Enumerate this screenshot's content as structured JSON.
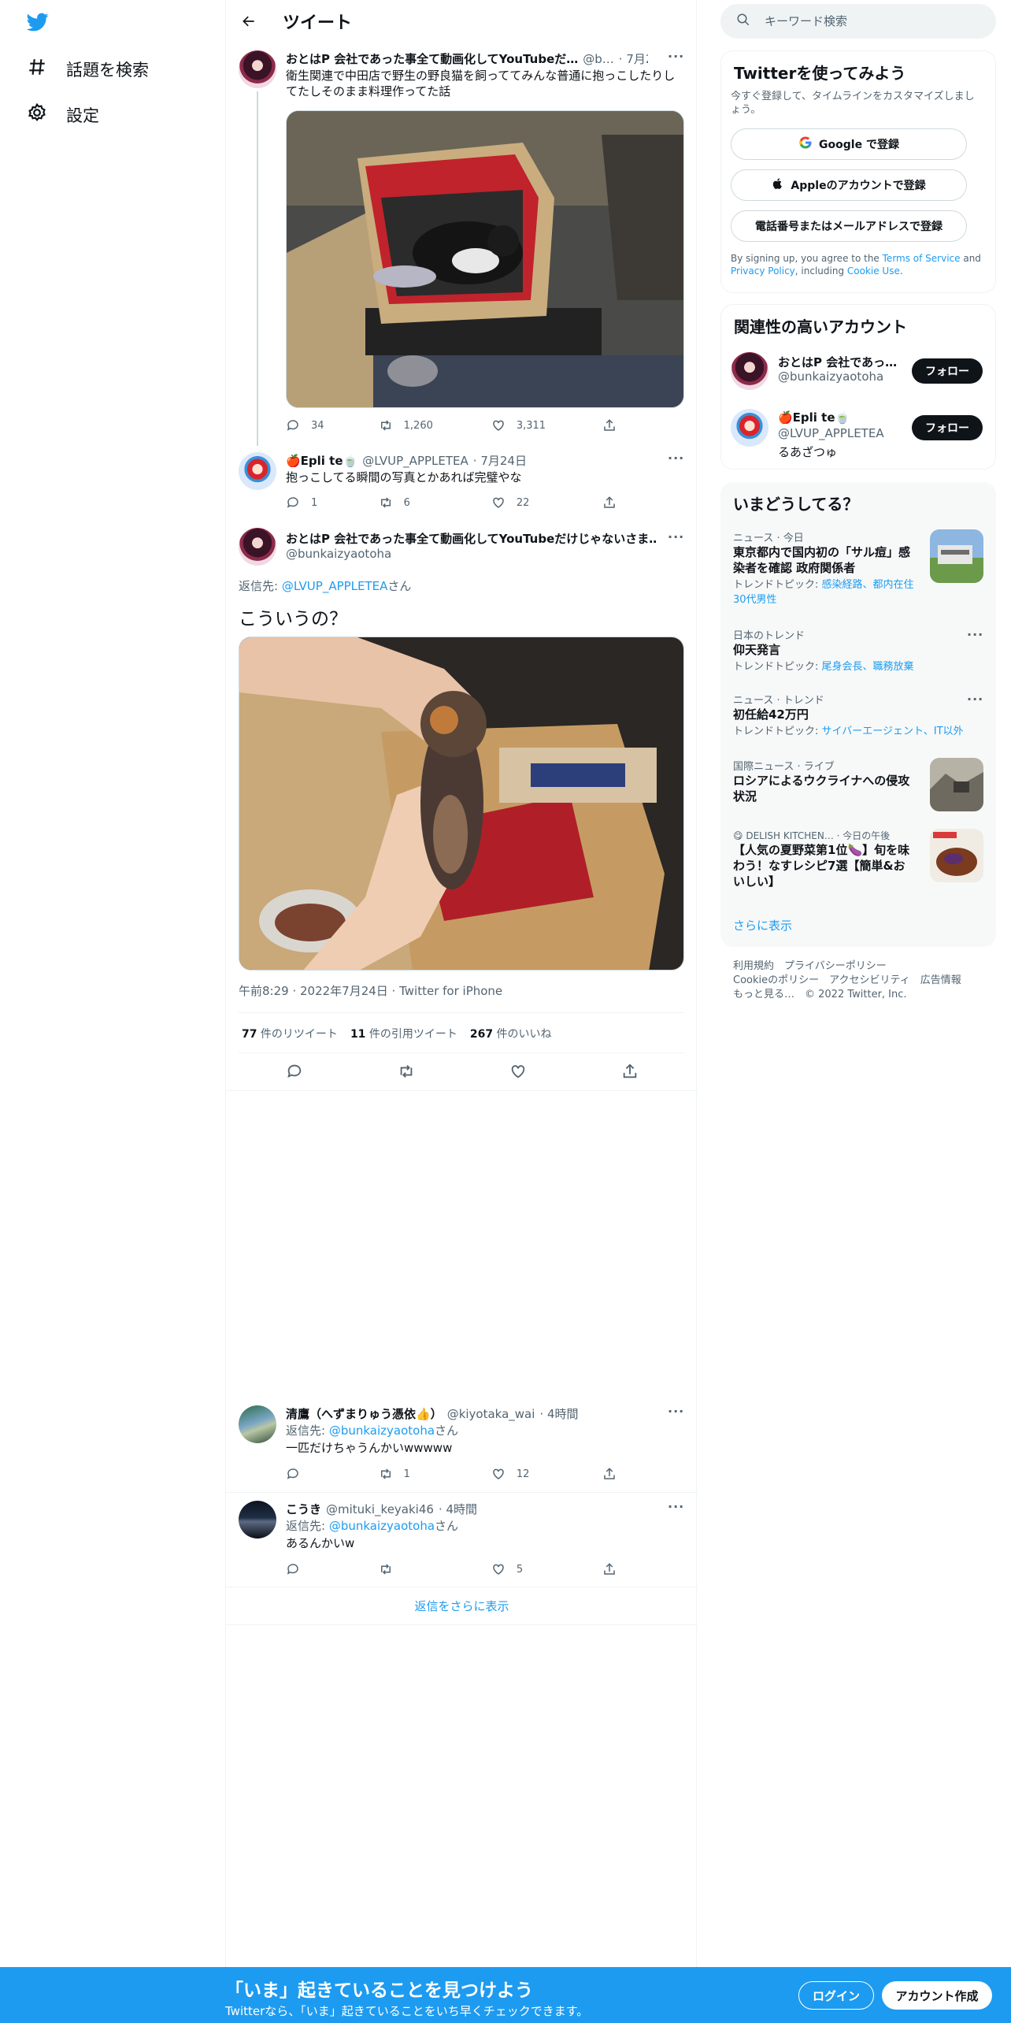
{
  "nav": {
    "explore": "話題を検索",
    "settings": "設定"
  },
  "header": {
    "title": "ツイート"
  },
  "tweets": {
    "parent": {
      "name": "おとはP 会社であった事全て動画化してYouTubeだ…",
      "handle": "@b…",
      "time": "· 7月24日",
      "text": "衛生関連で中田店で野生の野良猫を飼っててみんな普通に抱っこしたりしてたしそのまま料理作ってた話",
      "replies": "34",
      "retweets": "1,260",
      "likes": "3,311"
    },
    "reply1": {
      "name": "🍎Epli te🍵",
      "handle": "@LVUP_APPLETEA",
      "time": "· 7月24日",
      "text": "抱っこしてる瞬間の写真とかあれば完璧やな",
      "replies": "1",
      "retweets": "6",
      "likes": "22"
    },
    "focus": {
      "name": "おとはP 会社であった事全て動画化してYouTubeだけじゃないさま…",
      "handle": "@bunkaizyaotoha",
      "reply_prefix": "返信先: ",
      "reply_to": "@LVUP_APPLETEA",
      "reply_suffix": "さん",
      "text": "こういうの？",
      "meta": "午前8:29 · 2022年7月24日 · Twitter for iPhone",
      "rt_count": "77",
      "rt_label": " 件のリツイート",
      "quote_count": "11",
      "quote_label": " 件の引用ツイート",
      "like_count": "267",
      "like_label": " 件のいいね"
    },
    "reply2": {
      "name": "清鷹（へずまりゅう憑依👍）",
      "handle": "@kiyotaka_wai",
      "time": "· 4時間",
      "reply_prefix": "返信先: ",
      "reply_to": "@bunkaizyaotoha",
      "reply_suffix": "さん",
      "text": "一匹だけちゃうんかいwwwww",
      "replies": "",
      "retweets": "1",
      "likes": "12"
    },
    "reply3": {
      "name": "こうき",
      "handle": "@mituki_keyaki46",
      "time": "· 4時間",
      "reply_prefix": "返信先: ",
      "reply_to": "@bunkaizyaotoha",
      "reply_suffix": "さん",
      "text": "あるんかいw",
      "replies": "",
      "retweets": "",
      "likes": "5"
    },
    "show_more": "返信をさらに表示"
  },
  "sidebar": {
    "search_placeholder": "キーワード検索",
    "signup": {
      "title": "Twitterを使ってみよう",
      "subtitle": "今すぐ登録して、タイムラインをカスタマイズしましょう。",
      "google": "Google で登録",
      "apple": "Appleのアカウントで登録",
      "phone": "電話番号またはメールアドレスで登録",
      "terms_1": "By signing up, you agree to the ",
      "terms_tos": "Terms of Service",
      "terms_2": " and ",
      "terms_pp": "Privacy Policy",
      "terms_3": ", including ",
      "terms_cookie": "Cookie Use",
      "terms_4": "."
    },
    "related": {
      "title": "関連性の高いアカウント",
      "accounts": [
        {
          "name": "おとはP 会社であっ…",
          "handle": "@bunkaizyaotoha",
          "bio": "",
          "button": "フォロー"
        },
        {
          "name": "🍎Epli te🍵",
          "handle": "@LVUP_APPLETEA",
          "bio": "るあざつゅ",
          "button": "フォロー"
        }
      ]
    },
    "trends": {
      "title": "いまどうしてる？",
      "items": [
        {
          "context": "ニュース · 今日",
          "title": "東京都内で国内初の「サル痘」感染者を確認 政府関係者",
          "sub_prefix": "トレンドトピック: ",
          "sub": "感染経路、都内在住30代男性"
        },
        {
          "context": "日本のトレンド",
          "title": "仰天発言",
          "sub_prefix": "トレンドトピック: ",
          "sub": "尾身会長、職務放棄"
        },
        {
          "context": "ニュース · トレンド",
          "title": "初任給42万円",
          "sub_prefix": "トレンドトピック: ",
          "sub": "サイバーエージェント、IT以外"
        },
        {
          "context": "国際ニュース · ライブ",
          "title": "ロシアによるウクライナへの侵攻状況",
          "sub_prefix": "",
          "sub": ""
        },
        {
          "context": "DELISH KITCHEN… · 今日の午後",
          "title": "【人気の夏野菜第1位🍆】旬を味わう！なすレシピ7選【簡単&おいしい】",
          "sub_prefix": "",
          "sub": ""
        }
      ],
      "show_more": "さらに表示"
    },
    "footer": {
      "line1": "利用規約　プライバシーポリシー",
      "line2": "Cookieのポリシー　アクセシビリティ　広告情報",
      "line3": "もっと見る…　© 2022 Twitter, Inc."
    }
  },
  "banner": {
    "headline": "「いま」起きていることを見つけよう",
    "sub": "Twitterなら、「いま」起きていることをいち早くチェックできます。",
    "login": "ログイン",
    "signup": "アカウント作成"
  },
  "colors": {
    "brand": "#1d9bf0",
    "text": "#0f1419",
    "muted": "#536471"
  }
}
